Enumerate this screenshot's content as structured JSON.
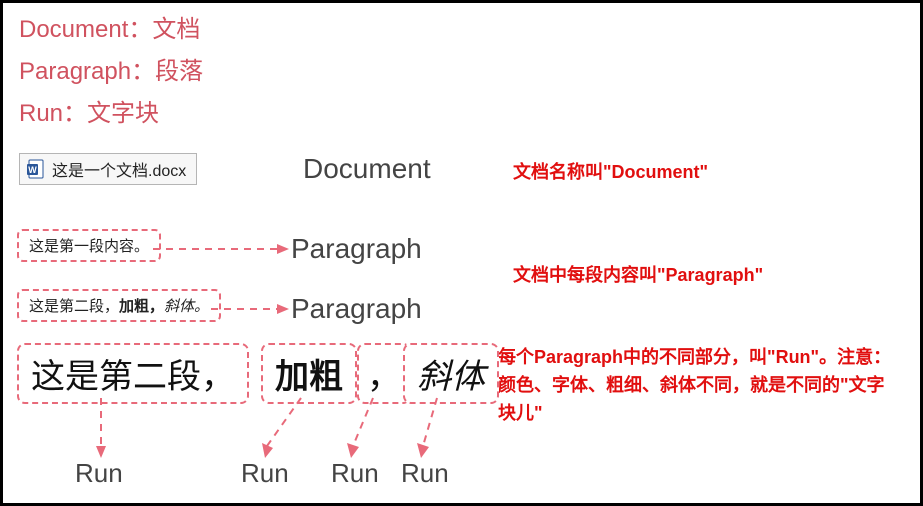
{
  "glossary": {
    "doc": "Document：文档",
    "para": "Paragraph：段落",
    "run": "Run：文字块"
  },
  "doc_chip": "这是一个文档.docx",
  "labels": {
    "document": "Document",
    "paragraph1": "Paragraph",
    "paragraph2": "Paragraph"
  },
  "annotations": {
    "doc": "文档名称叫\"Document\"",
    "para": "文档中每段内容叫\"Paragraph\"",
    "run": "每个Paragraph中的不同部分，叫\"Run\"。注意：颜色、字体、粗细、斜体不同，就是不同的\"文字块儿\""
  },
  "paragraphs": {
    "p1": "这是第一段内容。",
    "p2_pre": "这是第二段，",
    "p2_bold": "加粗，",
    "p2_italic": "斜体。"
  },
  "big_runs": {
    "r1": "这是第二段，",
    "r2": "加粗",
    "r3": "，",
    "r4": "斜体"
  },
  "run_label": "Run"
}
